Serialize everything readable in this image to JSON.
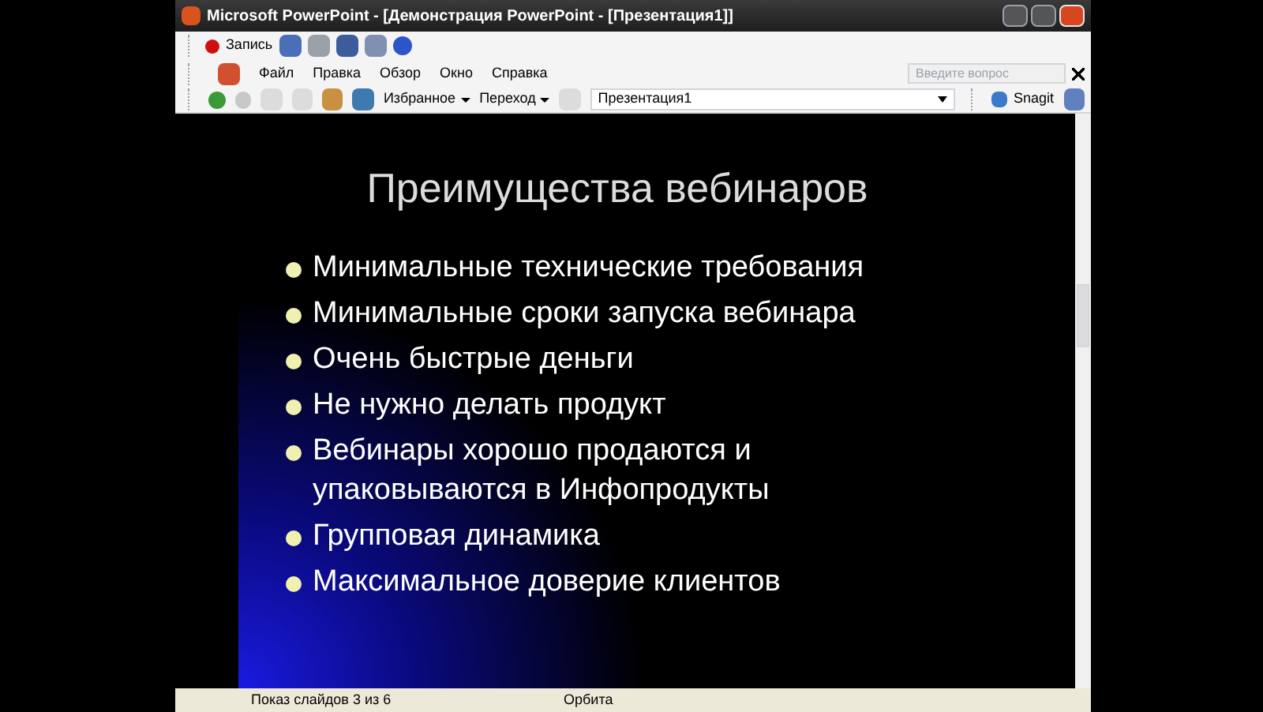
{
  "window": {
    "title": "Microsoft PowerPoint - [Демонстрация PowerPoint - [Презентация1]]"
  },
  "record_toolbar": {
    "record_label": "Запись"
  },
  "menu": {
    "items": [
      "Файл",
      "Правка",
      "Обзор",
      "Окно",
      "Справка"
    ],
    "question": {
      "placeholder": "Введите вопрос"
    }
  },
  "web_toolbar": {
    "favorites": "Избранное",
    "go": "Переход",
    "address": "Презентация1",
    "snagit": "Snagit"
  },
  "slide": {
    "title": "Преимущества вебинаров",
    "bullets": [
      "Минимальные технические требования",
      "Минимальные сроки запуска вебинара",
      "Очень быстрые деньги",
      "Не нужно делать продукт",
      "Вебинары хорошо продаются и упаковываются в Инфопродукты",
      "Групповая динамика",
      "Максимальное доверие клиентов"
    ]
  },
  "status_bar": {
    "slide_count": "Показ слайдов 3 из 6",
    "design": "Орбита"
  }
}
